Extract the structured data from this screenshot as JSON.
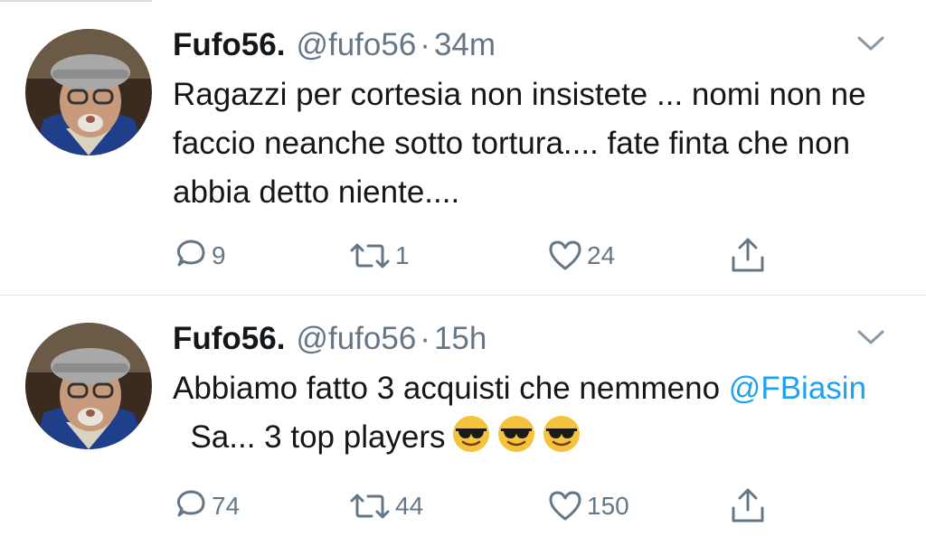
{
  "tweets": [
    {
      "display_name": "Fufo56.",
      "handle": "@fufo56",
      "separator": "·",
      "time": "34m",
      "text": "Ragazzi per cortesia non insistete ... nomi non ne faccio neanche sotto tortura.... fate finta che non abbia detto niente....",
      "replies": "9",
      "retweets": "1",
      "likes": "24"
    },
    {
      "display_name": "Fufo56.",
      "handle": "@fufo56",
      "separator": "·",
      "time": "15h",
      "text_before": "Abbiamo fatto 3 acquisti che nemmeno ",
      "mention": "@FBiasin",
      "text_after": "  Sa... 3 top players",
      "emoji": [
        "sunglasses-emoji",
        "sunglasses-emoji",
        "sunglasses-emoji"
      ],
      "replies": "74",
      "retweets": "44",
      "likes": "150"
    }
  ],
  "icons": [
    "reply-icon",
    "retweet-icon",
    "like-icon",
    "share-icon",
    "chevron-down-icon"
  ],
  "colors": {
    "text": "#14171a",
    "secondary": "#657786",
    "link": "#1da1f2",
    "divider": "#e1e8ed"
  }
}
